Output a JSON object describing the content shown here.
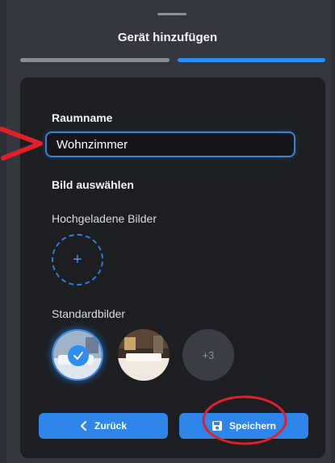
{
  "sheet": {
    "title": "Gerät hinzufügen",
    "progress_step": 2,
    "progress_total": 2
  },
  "form": {
    "room_name_label": "Raumname",
    "room_name_value": "Wohnzimmer",
    "choose_image_heading": "Bild auswählen",
    "uploaded_images_label": "Hochgeladene Bilder",
    "upload_plus": "+",
    "default_images_label": "Standardbilder",
    "more_count": "+3",
    "selected_default_index": 0
  },
  "actions": {
    "back_label": "Zurück",
    "save_label": "Speichern"
  },
  "colors": {
    "accent": "#2f8cf0",
    "annotation": "#e0202a"
  }
}
